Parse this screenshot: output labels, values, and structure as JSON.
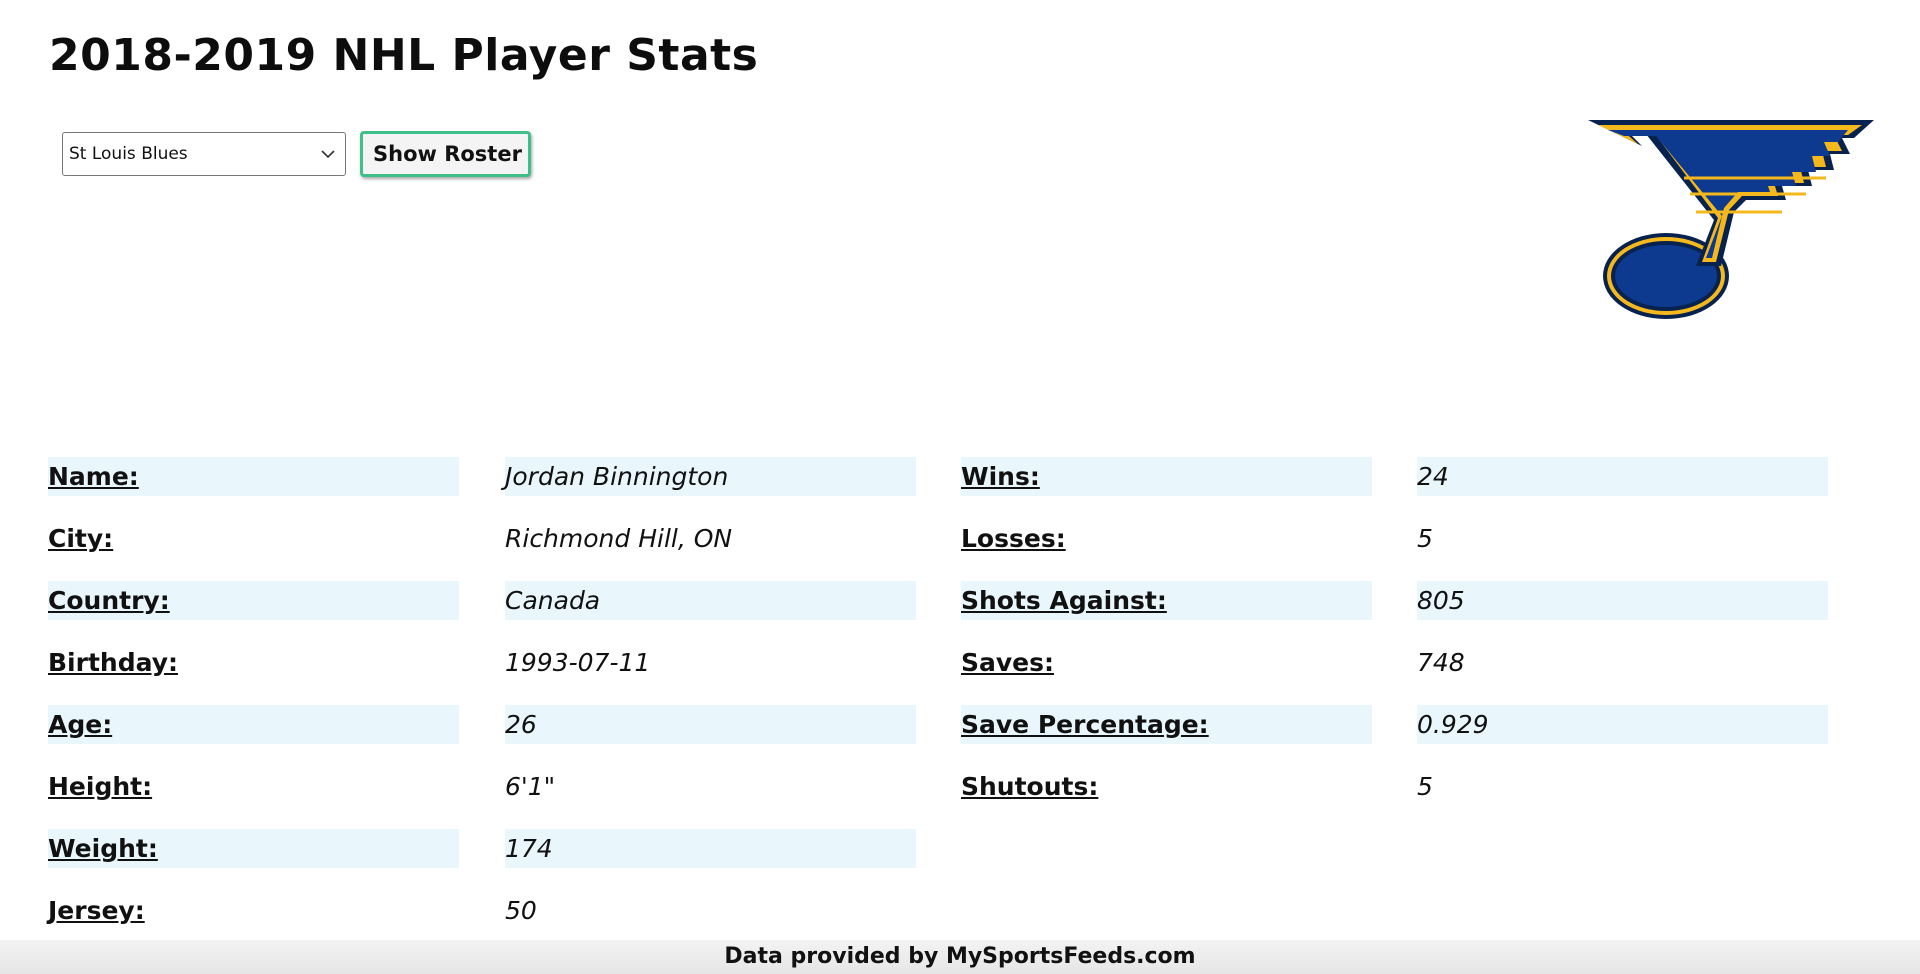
{
  "page_title": "2018-2019 NHL Player Stats",
  "controls": {
    "team_selected": "St Louis Blues",
    "show_roster_label": "Show Roster"
  },
  "logo": {
    "icon": "st-louis-blues-note-logo",
    "colors": {
      "blue": "#0d3a8e",
      "gold": "#f5b81c",
      "navy": "#07224f"
    }
  },
  "player_info": [
    {
      "label": "Name:",
      "value": "Jordan Binnington"
    },
    {
      "label": "City:",
      "value": "Richmond Hill, ON"
    },
    {
      "label": "Country:",
      "value": "Canada"
    },
    {
      "label": "Birthday:",
      "value": "1993-07-11"
    },
    {
      "label": "Age:",
      "value": "26"
    },
    {
      "label": "Height:",
      "value": "6'1\""
    },
    {
      "label": "Weight:",
      "value": "174"
    },
    {
      "label": "Jersey:",
      "value": "50"
    }
  ],
  "goalie_stats": [
    {
      "label": "Wins:",
      "value": "24"
    },
    {
      "label": "Losses:",
      "value": "5"
    },
    {
      "label": "Shots Against:",
      "value": "805"
    },
    {
      "label": "Saves:",
      "value": "748"
    },
    {
      "label": "Save Percentage:",
      "value": "0.929"
    },
    {
      "label": "Shutouts:",
      "value": "5"
    }
  ],
  "footer": {
    "text": "Data provided by MySportsFeeds.com"
  },
  "colors": {
    "row_shade": "#e9f6fb",
    "button_border": "#3fbf8a"
  }
}
